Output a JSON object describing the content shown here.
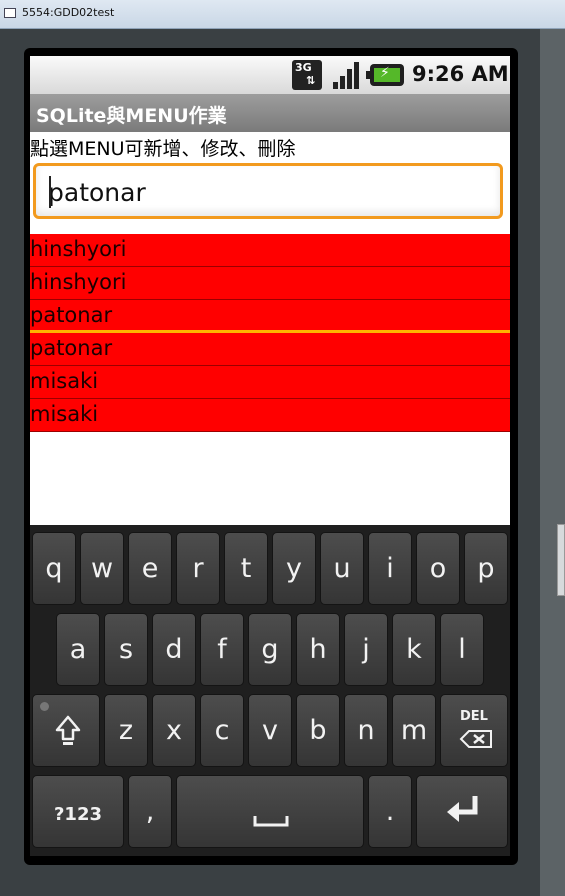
{
  "window": {
    "title": "5554:GDD02test"
  },
  "status_bar": {
    "network": "3G",
    "time": "9:26 AM"
  },
  "app": {
    "title": "SQLite與MENU作業",
    "instruction": "點選MENU可新增、修改、刪除",
    "input_value": "patonar"
  },
  "list": {
    "items": [
      {
        "label": "hinshyori"
      },
      {
        "label": "hinshyori"
      },
      {
        "label": "patonar"
      },
      {
        "label": "patonar"
      },
      {
        "label": "misaki"
      },
      {
        "label": "misaki"
      }
    ]
  },
  "keyboard": {
    "row1": [
      "q",
      "w",
      "e",
      "r",
      "t",
      "y",
      "u",
      "i",
      "o",
      "p"
    ],
    "row2": [
      "a",
      "s",
      "d",
      "f",
      "g",
      "h",
      "j",
      "k",
      "l"
    ],
    "row3": [
      "z",
      "x",
      "c",
      "v",
      "b",
      "n",
      "m"
    ],
    "del_label": "DEL",
    "symbols_label": "?123",
    "comma_label": ",",
    "period_label": "."
  },
  "colors": {
    "list_background": "#ff0000",
    "focus_border": "#f29a1e",
    "selection_line": "#ffb400"
  }
}
